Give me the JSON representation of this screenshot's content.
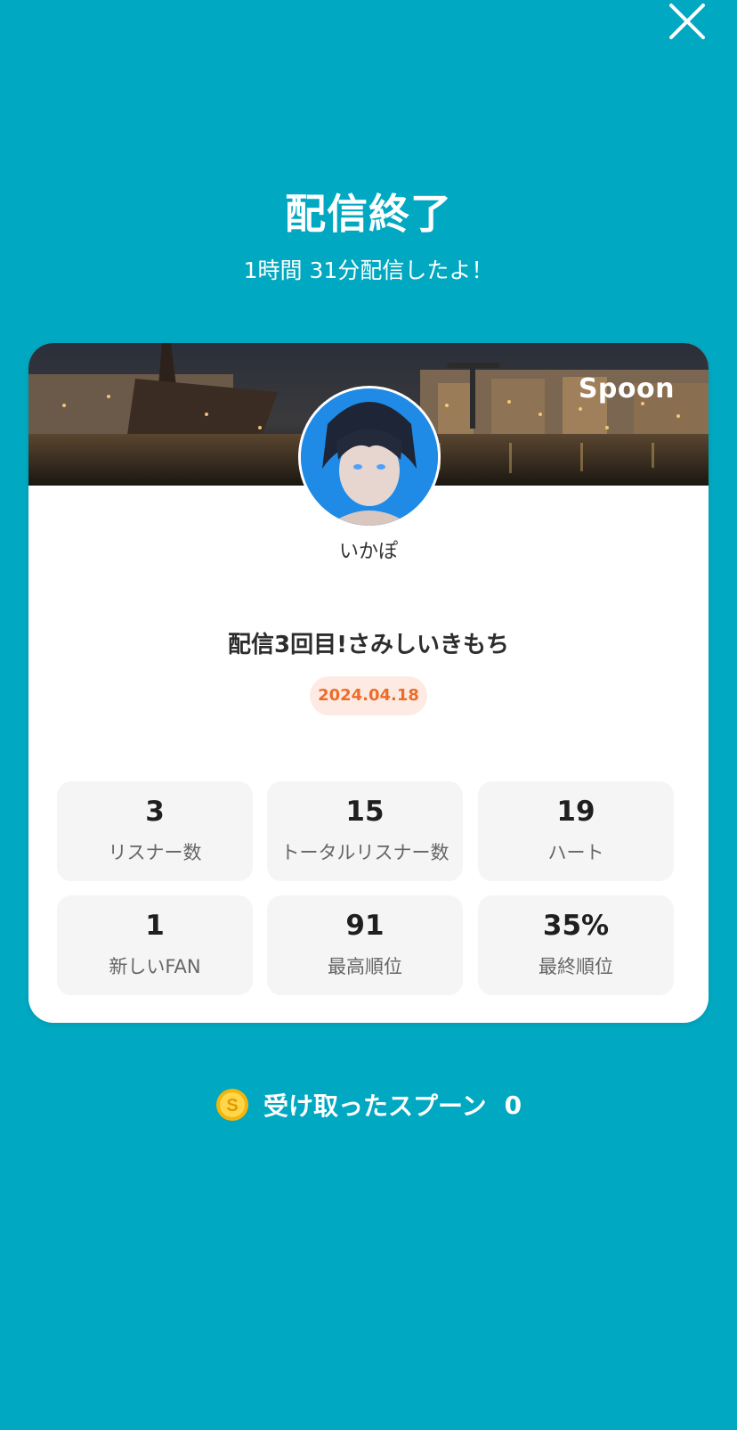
{
  "header": {
    "title": "配信終了",
    "duration_text": "1時間 31分配信したよ！"
  },
  "card": {
    "brand": "Spoon",
    "username": "いかぽ",
    "live_title": "配信3回目!さみしいきもち",
    "date": "2024.04.18"
  },
  "stats": [
    {
      "value": "3",
      "label": "リスナー数"
    },
    {
      "value": "15",
      "label": "トータルリスナー数"
    },
    {
      "value": "19",
      "label": "ハート"
    },
    {
      "value": "1",
      "label": "新しいFAN"
    },
    {
      "value": "91",
      "label": "最高順位"
    },
    {
      "value": "35%",
      "label": "最終順位"
    }
  ],
  "spoons": {
    "label": "受け取ったスプーン",
    "count": "0"
  },
  "icons": {
    "close": "close-icon",
    "coin": "coin-icon"
  },
  "colors": {
    "background": "#01a8c1",
    "date_badge_bg": "#fdebe3",
    "date_badge_text": "#f06b2a",
    "coin": "#f5b50a"
  }
}
